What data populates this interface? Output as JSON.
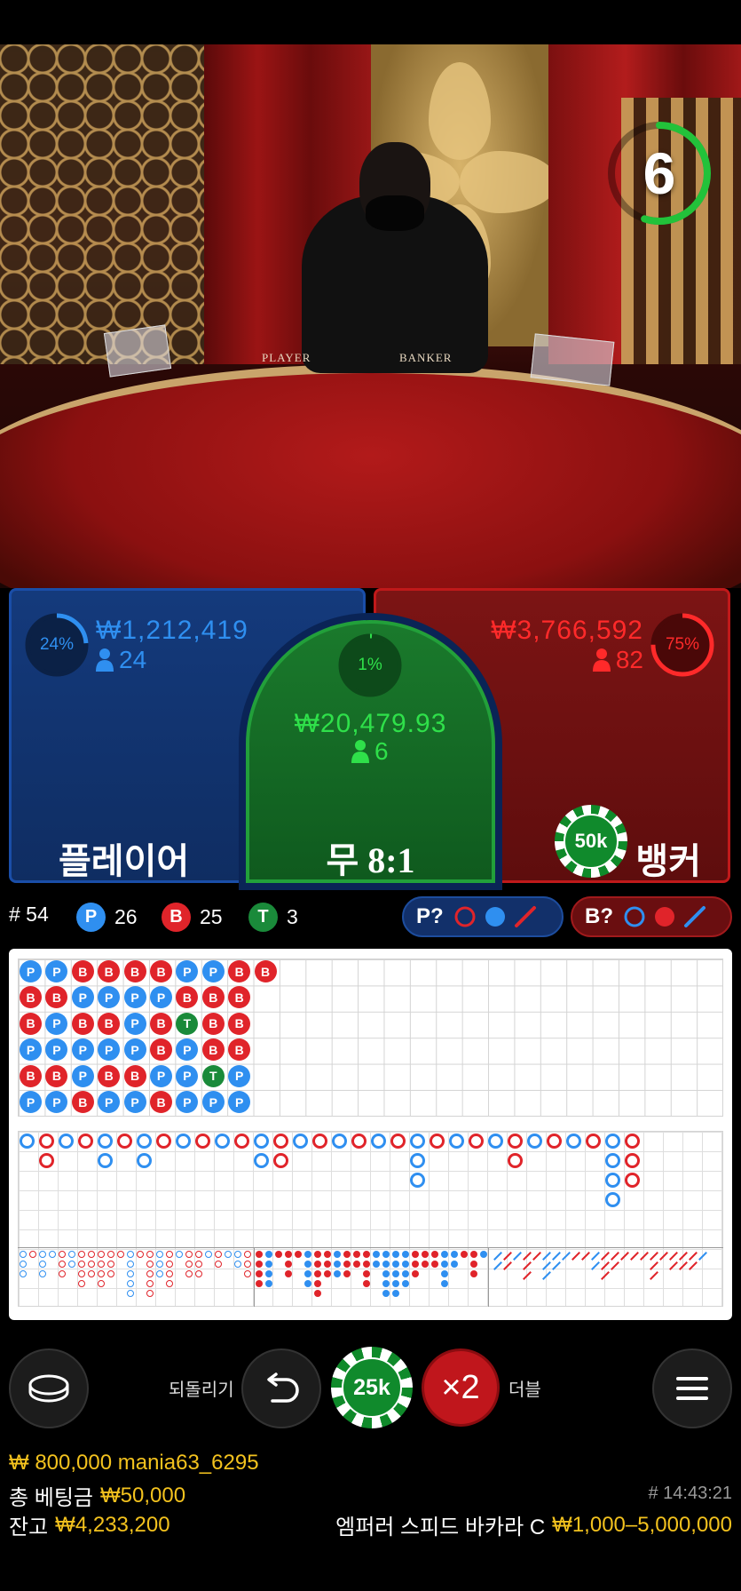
{
  "timer": {
    "seconds": "6",
    "progress": 0.55,
    "color": "#22c23a"
  },
  "table_text": {
    "player": "PLAYER",
    "banker": "BANKER"
  },
  "bets": {
    "player": {
      "percent": "24%",
      "percent_value": 0.24,
      "amount": "₩1,212,419",
      "count": "24",
      "label": "플레이어",
      "color": "#2f8ff0"
    },
    "tie": {
      "percent": "1%",
      "percent_value": 0.01,
      "amount": "₩20,479.93",
      "count": "6",
      "label": "무 8:1",
      "color": "#2fe04a"
    },
    "banker": {
      "percent": "75%",
      "percent_value": 0.75,
      "amount": "₩3,766,592",
      "count": "82",
      "label": "뱅커",
      "color": "#ff2a2a"
    },
    "placed_chip": "50k"
  },
  "stats": {
    "round": "# 54",
    "player": {
      "letter": "P",
      "count": "26"
    },
    "banker": {
      "letter": "B",
      "count": "25"
    },
    "tie": {
      "letter": "T",
      "count": "3"
    },
    "player_prediction": "P?",
    "banker_prediction": "B?"
  },
  "bead_road": [
    [
      "P",
      "B",
      "B",
      "P",
      "B",
      "P"
    ],
    [
      "P",
      "B",
      "P",
      "P",
      "B",
      "P"
    ],
    [
      "B",
      "P",
      "B",
      "P",
      "P",
      "B"
    ],
    [
      "B",
      "P",
      "B",
      "P",
      "B",
      "P"
    ],
    [
      "B",
      "P",
      "P",
      "P",
      "B",
      "P"
    ],
    [
      "B",
      "P",
      "B",
      "B",
      "P",
      "B"
    ],
    [
      "P",
      "B",
      "T",
      "P",
      "P",
      "P"
    ],
    [
      "P",
      "B",
      "B",
      "B",
      "T",
      "P"
    ],
    [
      "B",
      "B",
      "B",
      "B",
      "P",
      "P"
    ],
    [
      "B",
      "",
      "",
      "",
      "",
      ""
    ]
  ],
  "controls": {
    "undo_label": "되돌리기",
    "double_label": "더블",
    "chip": "25k",
    "double_symbol": "×2"
  },
  "footer": {
    "win_line": "₩ 800,000 mania63_6295",
    "total_bet_label": "총 베팅금",
    "total_bet": "₩50,000",
    "balance_label": "잔고",
    "balance": "₩4,233,200",
    "time": "# 14:43:21",
    "table_name": "엠퍼러 스피드 바카라 C",
    "limits": "₩1,000–5,000,000"
  },
  "colors": {
    "player": "#2f8ff0",
    "banker": "#e0242a",
    "tie": "#1a8a3a",
    "gold": "#f3c21e"
  }
}
